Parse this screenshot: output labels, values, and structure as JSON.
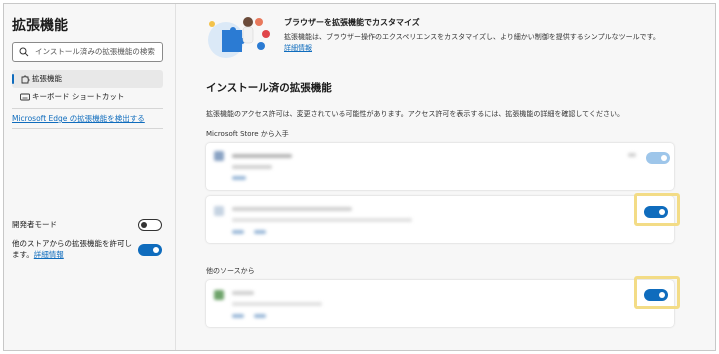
{
  "sidebar": {
    "title": "拡張機能",
    "search_placeholder": "インストール済みの拡張機能の検索",
    "items": [
      {
        "label": "拡張機能",
        "icon": "puzzle-icon",
        "active": true
      },
      {
        "label": "キーボード ショートカット",
        "icon": "keyboard-icon",
        "active": false
      }
    ],
    "discover_link": "Microsoft Edge の拡張機能を検出する",
    "developer_mode_label": "開発者モード",
    "developer_mode_on": false,
    "allow_other_stores_label": "他のストアからの拡張機能を許可します。",
    "allow_other_stores_link": "詳細情報",
    "allow_other_stores_on": true
  },
  "promo": {
    "title": "ブラウザーを拡張機能でカスタマイズ",
    "desc": "拡張機能は、ブラウザー操作のエクスペリエンスをカスタマイズし、より細かい制御を提供するシンプルなツールです。",
    "link": "詳細情報"
  },
  "main": {
    "heading": "インストール済の拡張機能",
    "permission_note": "拡張機能のアクセス許可は、変更されている可能性があります。アクセス許可を表示するには、拡張機能の詳細を確認してください。",
    "store_label": "Microsoft Store から入手",
    "other_sources_label": "他のソースから"
  },
  "extensions": [
    {
      "source": "store",
      "enabled": true,
      "dimmed": true
    },
    {
      "source": "store",
      "enabled": true,
      "highlighted": true
    },
    {
      "source": "other",
      "enabled": true,
      "highlighted": true
    }
  ],
  "colors": {
    "accent": "#0f6cbd",
    "highlight": "#f3dc86",
    "background": "#f7f7f7"
  }
}
